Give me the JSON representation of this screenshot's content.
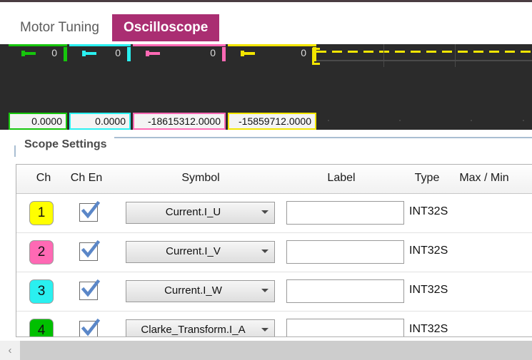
{
  "tabs": {
    "inactive_label": "Motor Tuning",
    "active_label": "Oscilloscope",
    "active_color": "#aa2e72"
  },
  "scope": {
    "channels": [
      {
        "glyph": "offset-marker-icon",
        "zero": "0",
        "color": "#16c60c",
        "value": "0.0000"
      },
      {
        "glyph": "offset-marker-icon",
        "zero": "0",
        "color": "#2af0f0",
        "value": "0.0000"
      },
      {
        "glyph": "offset-marker-icon",
        "zero": "0",
        "color": "#ff69b4",
        "value": "-18615312.0000"
      },
      {
        "glyph": "offset-marker-icon",
        "zero": "0",
        "color": "#f2e500",
        "value": "-15859712.0000"
      }
    ],
    "trace_color": "#f2e500",
    "slider_value": "0"
  },
  "group": {
    "title": "Scope Settings"
  },
  "table": {
    "headers": [
      "Ch",
      "Ch En",
      "Symbol",
      "Label",
      "Type",
      "Max / Min"
    ],
    "rows": [
      {
        "ch": "1",
        "ch_color": "#ffff00",
        "enabled": true,
        "symbol": "Current.I_U",
        "label": "",
        "type": "INT32S"
      },
      {
        "ch": "2",
        "ch_color": "#ff69b4",
        "enabled": true,
        "symbol": "Current.I_V",
        "label": "",
        "type": "INT32S"
      },
      {
        "ch": "3",
        "ch_color": "#2af0f0",
        "enabled": true,
        "symbol": "Current.I_W",
        "label": "",
        "type": "INT32S"
      },
      {
        "ch": "4",
        "ch_color": "#00c000",
        "enabled": true,
        "symbol": "Clarke_Transform.I_A",
        "label": "",
        "type": "INT32S"
      }
    ]
  },
  "scrollbar": {
    "left_arrow": "‹"
  }
}
